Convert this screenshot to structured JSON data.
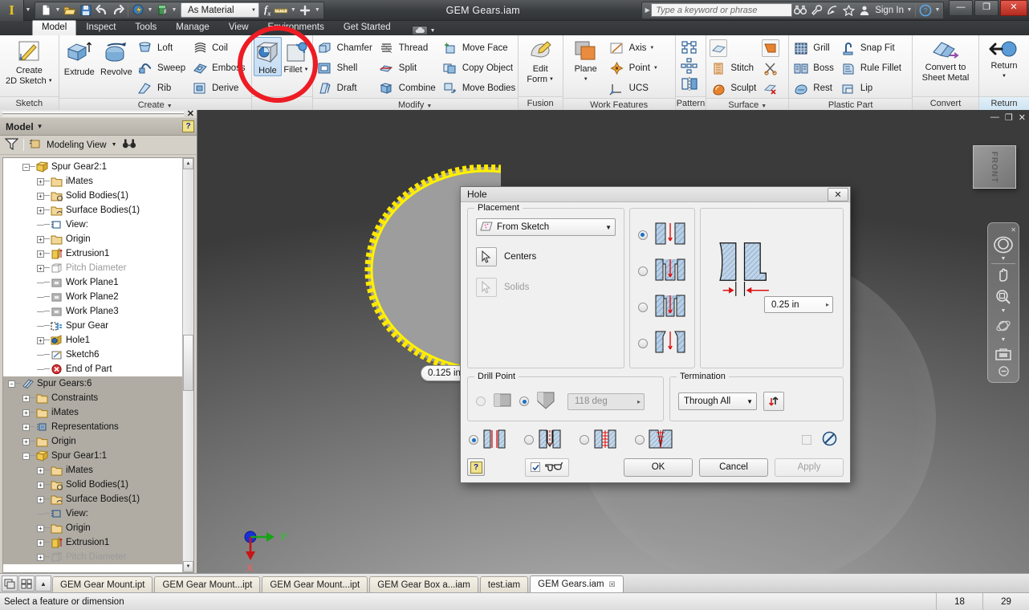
{
  "titlebar": {
    "logo_glyph": "I",
    "material_selector": "As Material",
    "document_title": "GEM Gears.iam",
    "search_placeholder": "Type a keyword or phrase",
    "sign_in": "Sign In",
    "minimize": "—",
    "restore": "❐",
    "close": "✕",
    "quick_access": [
      {
        "name": "new-document",
        "label": "New"
      },
      {
        "name": "open-document",
        "label": "Open"
      },
      {
        "name": "save-document",
        "label": "Save"
      },
      {
        "name": "undo",
        "label": "Undo"
      },
      {
        "name": "redo",
        "label": "Redo"
      },
      {
        "name": "appearance",
        "label": "Appearance"
      },
      {
        "name": "material",
        "label": "Material"
      },
      {
        "name": "parameters",
        "label": "Parameters"
      },
      {
        "name": "measure",
        "label": "Measure"
      },
      {
        "name": "add-to-qat",
        "label": "Add"
      }
    ],
    "help_icons": [
      {
        "name": "search-help",
        "label": "Search Help"
      },
      {
        "name": "wrench",
        "label": "Tools"
      },
      {
        "name": "satellite",
        "label": "Subscription"
      },
      {
        "name": "favorites-star",
        "label": "Favorites"
      }
    ]
  },
  "ribbon_tabs": [
    {
      "label": "Model",
      "active": true
    },
    {
      "label": "Inspect",
      "active": false
    },
    {
      "label": "Tools",
      "active": false
    },
    {
      "label": "Manage",
      "active": false
    },
    {
      "label": "View",
      "active": false
    },
    {
      "label": "Environments",
      "active": false
    },
    {
      "label": "Get Started",
      "active": false
    }
  ],
  "ribbon_panels": [
    {
      "name": "sketch",
      "label": "Sketch",
      "has_caret": false,
      "big_buttons": [
        {
          "label": "Create\n2D Sketch",
          "line1": "Create",
          "line2": "2D Sketch",
          "icon": "sketch-icon",
          "has_caret": true
        }
      ],
      "small_buttons": []
    },
    {
      "name": "create",
      "label": "Create",
      "has_caret": true,
      "big_buttons": [
        {
          "line1": "Extrude",
          "line2": "",
          "icon": "extrude-icon",
          "has_caret": false
        },
        {
          "line1": "Revolve",
          "line2": "",
          "icon": "revolve-icon",
          "has_caret": false
        }
      ],
      "small_buttons": [
        {
          "label": "Loft",
          "icon": "loft-icon"
        },
        {
          "label": "Sweep",
          "icon": "sweep-icon"
        },
        {
          "label": "Rib",
          "icon": "rib-icon"
        },
        {
          "label": "Coil",
          "icon": "coil-icon"
        },
        {
          "label": "Emboss",
          "icon": "emboss-icon"
        },
        {
          "label": "Derive",
          "icon": "derive-icon"
        }
      ]
    },
    {
      "name": "hole-fillet",
      "label": "",
      "has_caret": false,
      "big_buttons": [
        {
          "line1": "Hole",
          "line2": "",
          "icon": "hole-icon",
          "highlighted": true
        },
        {
          "line1": "Fillet",
          "line2": "",
          "icon": "fillet-icon",
          "has_caret": true
        }
      ],
      "small_buttons": []
    },
    {
      "name": "modify",
      "label": "Modify",
      "has_caret": true,
      "big_buttons": [],
      "small_buttons": [
        {
          "label": "Chamfer",
          "icon": "chamfer-icon"
        },
        {
          "label": "Shell",
          "icon": "shell-icon"
        },
        {
          "label": "Draft",
          "icon": "draft-icon"
        },
        {
          "label": "Thread",
          "icon": "thread-icon"
        },
        {
          "label": "Split",
          "icon": "split-icon"
        },
        {
          "label": "Combine",
          "icon": "combine-icon"
        },
        {
          "label": "Move Face",
          "icon": "move-face-icon"
        },
        {
          "label": "Copy Object",
          "icon": "copy-object-icon"
        },
        {
          "label": "Move Bodies",
          "icon": "move-bodies-icon"
        }
      ]
    },
    {
      "name": "fusion",
      "label": "Fusion",
      "has_caret": false,
      "big_buttons": [
        {
          "line1": "Edit",
          "line2": "Form",
          "icon": "edit-form-icon",
          "has_caret": true
        }
      ],
      "small_buttons": []
    },
    {
      "name": "work-features",
      "label": "Work Features",
      "has_caret": false,
      "big_buttons": [
        {
          "line1": "Plane",
          "line2": "",
          "icon": "plane-icon",
          "has_caret": true
        }
      ],
      "small_buttons": [
        {
          "label": "Axis",
          "icon": "axis-icon",
          "has_caret": true
        },
        {
          "label": "Point",
          "icon": "point-icon",
          "has_caret": true
        },
        {
          "label": "UCS",
          "icon": "ucs-icon"
        }
      ]
    },
    {
      "name": "pattern",
      "label": "Pattern",
      "has_caret": false,
      "big_buttons": [],
      "icons": [
        {
          "name": "rectangular-pattern-icon"
        },
        {
          "name": "circular-pattern-icon"
        },
        {
          "name": "mirror-icon"
        }
      ]
    },
    {
      "name": "surface",
      "label": "Surface",
      "has_caret": true,
      "big_buttons": [],
      "small_buttons": [
        {
          "label": "",
          "icon": "thicken-offset-icon"
        },
        {
          "label": "Stitch",
          "icon": "stitch-icon"
        },
        {
          "label": "Sculpt",
          "icon": "sculpt-icon"
        },
        {
          "label": "",
          "icon": "patch-icon"
        },
        {
          "label": "",
          "icon": "trim-icon"
        },
        {
          "label": "",
          "icon": "delete-face-icon"
        }
      ]
    },
    {
      "name": "plastic-part",
      "label": "Plastic Part",
      "has_caret": false,
      "big_buttons": [],
      "small_buttons": [
        {
          "label": "Grill",
          "icon": "grill-icon"
        },
        {
          "label": "Boss",
          "icon": "boss-icon"
        },
        {
          "label": "Rest",
          "icon": "rest-icon"
        },
        {
          "label": "Snap Fit",
          "icon": "snap-fit-icon"
        },
        {
          "label": "Rule Fillet",
          "icon": "rule-fillet-icon"
        },
        {
          "label": "Lip",
          "icon": "lip-icon"
        }
      ]
    },
    {
      "name": "convert",
      "label": "Convert",
      "has_caret": false,
      "big_buttons": [
        {
          "line1": "Convert to",
          "line2": "Sheet Metal",
          "icon": "convert-sheet-metal-icon",
          "has_caret": false
        }
      ],
      "small_buttons": []
    },
    {
      "name": "return",
      "label": "Return",
      "has_caret": false,
      "big_buttons": [
        {
          "line1": "Return",
          "line2": "",
          "icon": "return-icon",
          "has_caret": true
        }
      ],
      "small_buttons": []
    }
  ],
  "browser": {
    "panel_title": "Model",
    "close_glyph": "✕",
    "help_glyph": "?",
    "view_label": "Modeling View",
    "filter_icon": "filter-icon",
    "find_icon": "binoculars-icon",
    "tree": [
      {
        "label": "Spur Gear2:1",
        "indent": 1,
        "expander": "minus",
        "icon": "part-icon",
        "dim": false,
        "selected": false
      },
      {
        "label": "iMates",
        "indent": 2,
        "expander": "plus",
        "icon": "folder-icon",
        "dim": false,
        "selected": false
      },
      {
        "label": "Solid Bodies(1)",
        "indent": 2,
        "expander": "plus",
        "icon": "solid-bodies-icon",
        "dim": false,
        "selected": false
      },
      {
        "label": "Surface Bodies(1)",
        "indent": 2,
        "expander": "plus",
        "icon": "surface-bodies-icon",
        "dim": false,
        "selected": false
      },
      {
        "label": "View:",
        "indent": 2,
        "expander": "none",
        "icon": "view-rep-icon",
        "dim": false,
        "selected": false
      },
      {
        "label": "Origin",
        "indent": 2,
        "expander": "plus",
        "icon": "folder-icon",
        "dim": false,
        "selected": false
      },
      {
        "label": "Extrusion1",
        "indent": 2,
        "expander": "plus",
        "icon": "extrusion-icon",
        "dim": false,
        "selected": false
      },
      {
        "label": "Pitch Diameter",
        "indent": 2,
        "expander": "plus",
        "icon": "sketch-dim-icon",
        "dim": true,
        "selected": false
      },
      {
        "label": "Work Plane1",
        "indent": 2,
        "expander": "none",
        "icon": "workplane-icon",
        "dim": false,
        "selected": false
      },
      {
        "label": "Work Plane2",
        "indent": 2,
        "expander": "none",
        "icon": "workplane-icon",
        "dim": false,
        "selected": false
      },
      {
        "label": "Work Plane3",
        "indent": 2,
        "expander": "none",
        "icon": "workplane-icon",
        "dim": false,
        "selected": false
      },
      {
        "label": "Spur Gear",
        "indent": 2,
        "expander": "none",
        "icon": "spur-gear-icon",
        "dim": false,
        "selected": false
      },
      {
        "label": "Hole1",
        "indent": 2,
        "expander": "plus",
        "icon": "hole-feature-icon",
        "dim": false,
        "selected": false
      },
      {
        "label": "Sketch6",
        "indent": 2,
        "expander": "none",
        "icon": "sketch2-icon",
        "dim": false,
        "selected": false
      },
      {
        "label": "End of Part",
        "indent": 2,
        "expander": "none",
        "icon": "end-of-part-icon",
        "dim": false,
        "selected": false
      },
      {
        "label": "Spur Gears:6",
        "indent": 0,
        "expander": "minus",
        "icon": "assembly-icon",
        "dim": false,
        "selected": true
      },
      {
        "label": "Constraints",
        "indent": 1,
        "expander": "plus",
        "icon": "folder-icon",
        "dim": false,
        "selected": true
      },
      {
        "label": "iMates",
        "indent": 1,
        "expander": "plus",
        "icon": "folder-icon",
        "dim": false,
        "selected": true
      },
      {
        "label": "Representations",
        "indent": 1,
        "expander": "plus",
        "icon": "representations-icon",
        "dim": false,
        "selected": true
      },
      {
        "label": "Origin",
        "indent": 1,
        "expander": "plus",
        "icon": "folder-icon",
        "dim": false,
        "selected": true
      },
      {
        "label": "Spur Gear1:1",
        "indent": 1,
        "expander": "minus",
        "icon": "part-icon",
        "dim": false,
        "selected": true
      },
      {
        "label": "iMates",
        "indent": 2,
        "expander": "plus",
        "icon": "folder-icon",
        "dim": false,
        "selected": true
      },
      {
        "label": "Solid Bodies(1)",
        "indent": 2,
        "expander": "plus",
        "icon": "solid-bodies-icon",
        "dim": false,
        "selected": true
      },
      {
        "label": "Surface Bodies(1)",
        "indent": 2,
        "expander": "plus",
        "icon": "surface-bodies-icon",
        "dim": false,
        "selected": true
      },
      {
        "label": "View:",
        "indent": 2,
        "expander": "none",
        "icon": "view-rep-icon",
        "dim": false,
        "selected": true
      },
      {
        "label": "Origin",
        "indent": 2,
        "expander": "plus",
        "icon": "folder-icon",
        "dim": false,
        "selected": true
      },
      {
        "label": "Extrusion1",
        "indent": 2,
        "expander": "plus",
        "icon": "extrusion-icon",
        "dim": false,
        "selected": true
      },
      {
        "label": "Pitch Diameter",
        "indent": 2,
        "expander": "plus",
        "icon": "sketch-dim-icon",
        "dim": true,
        "selected": true
      }
    ]
  },
  "viewport": {
    "view_cube_face": "FRONT",
    "dimension_callout": "0.125 in",
    "axis_labels": {
      "x": "X",
      "y": "Y"
    },
    "minimize": "—",
    "maximize": "❐",
    "close": "✕",
    "annotation": {
      "type": "red-ellipse",
      "color": "#ed1c24",
      "target": "hole-button"
    },
    "navigation_tools": [
      {
        "name": "full-navigation-wheel-icon"
      },
      {
        "name": "pan-icon"
      },
      {
        "name": "zoom-icon"
      },
      {
        "name": "orbit-icon"
      },
      {
        "name": "look-at-icon"
      }
    ]
  },
  "dialog": {
    "title": "Hole",
    "close_glyph": "✕",
    "placement": {
      "legend": "Placement",
      "mode": "From Sketch",
      "mode_icon": "from-sketch-icon",
      "selectors": [
        {
          "label": "Centers",
          "icon": "cursor-arrow-icon",
          "enabled": true
        },
        {
          "label": "Solids",
          "icon": "cursor-arrow-icon",
          "enabled": false
        }
      ]
    },
    "hole_types": [
      {
        "name": "simple-hole",
        "selected": true
      },
      {
        "name": "counterbore-hole",
        "selected": false
      },
      {
        "name": "spotface-hole",
        "selected": false
      },
      {
        "name": "countersink-hole",
        "selected": false
      }
    ],
    "preview": {
      "diameter_value": "0.25 in",
      "spinner_glyph": "▸"
    },
    "drill_point": {
      "legend": "Drill Point",
      "options": [
        {
          "name": "flat-drill-point",
          "selected": false
        },
        {
          "name": "angle-drill-point",
          "selected": true
        }
      ],
      "angle_value": "118 deg",
      "angle_enabled": false
    },
    "termination": {
      "legend": "Termination",
      "value": "Through All",
      "flip_icon": "flip-direction-icon"
    },
    "bottom_types": [
      {
        "name": "simple-hole-bottom",
        "selected": true
      },
      {
        "name": "clearance-hole",
        "selected": false
      },
      {
        "name": "tapped-hole",
        "selected": false
      },
      {
        "name": "taper-tapped-hole",
        "selected": false
      }
    ],
    "extend_start_checkbox": {
      "checked": false,
      "enabled": false
    },
    "no-thread-icon": "no-thread-icon",
    "help_glyph": "?",
    "preview_checkbox": {
      "checked": true,
      "icon": "glasses-icon"
    },
    "buttons": [
      {
        "label": "OK",
        "enabled": true
      },
      {
        "label": "Cancel",
        "enabled": true
      },
      {
        "label": "Apply",
        "enabled": false
      }
    ]
  },
  "doc_tabs": {
    "controls": [
      {
        "name": "cascade-windows-icon"
      },
      {
        "name": "tile-windows-icon"
      },
      {
        "name": "tab-scroll-up-icon"
      }
    ],
    "tabs": [
      {
        "label": "GEM Gear Mount.ipt",
        "active": false
      },
      {
        "label": "GEM Gear Mount...ipt",
        "active": false
      },
      {
        "label": "GEM Gear Mount...ipt",
        "active": false
      },
      {
        "label": "GEM Gear Box a...iam",
        "active": false
      },
      {
        "label": "test.iam",
        "active": false
      },
      {
        "label": "GEM Gears.iam",
        "active": true,
        "close_glyph": "☒"
      }
    ]
  },
  "statusbar": {
    "message": "Select a feature or dimension",
    "cell1": "18",
    "cell2": "29"
  }
}
